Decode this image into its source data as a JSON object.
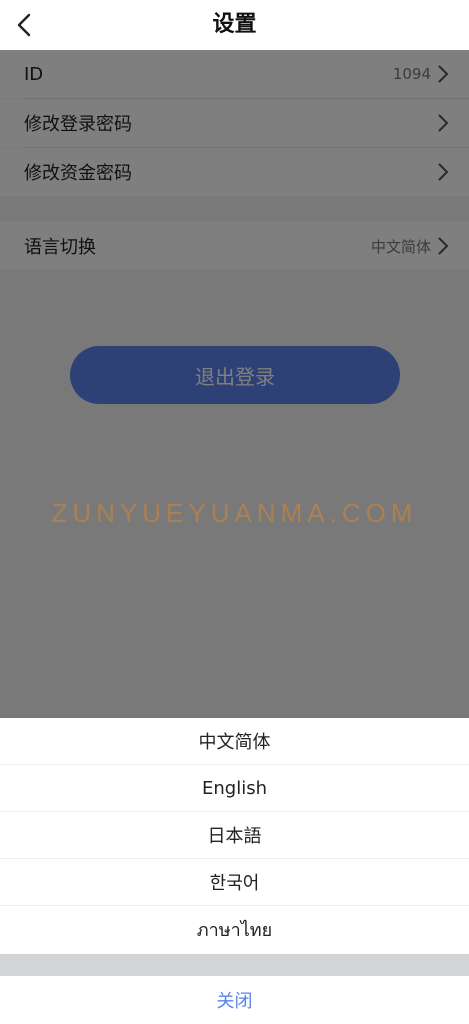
{
  "header": {
    "title": "设置"
  },
  "settings": {
    "id_label": "ID",
    "id_value": "1094",
    "change_login_password": "修改登录密码",
    "change_fund_password": "修改资金密码",
    "language_label": "语言切换",
    "language_value": "中文简体",
    "logout": "退出登录"
  },
  "watermark": "ZUNYUEYUANMA.COM",
  "language_sheet": {
    "options": [
      "中文简体",
      "English",
      "日本語",
      "한국어",
      "ภาษาไทย"
    ],
    "close": "关闭"
  }
}
